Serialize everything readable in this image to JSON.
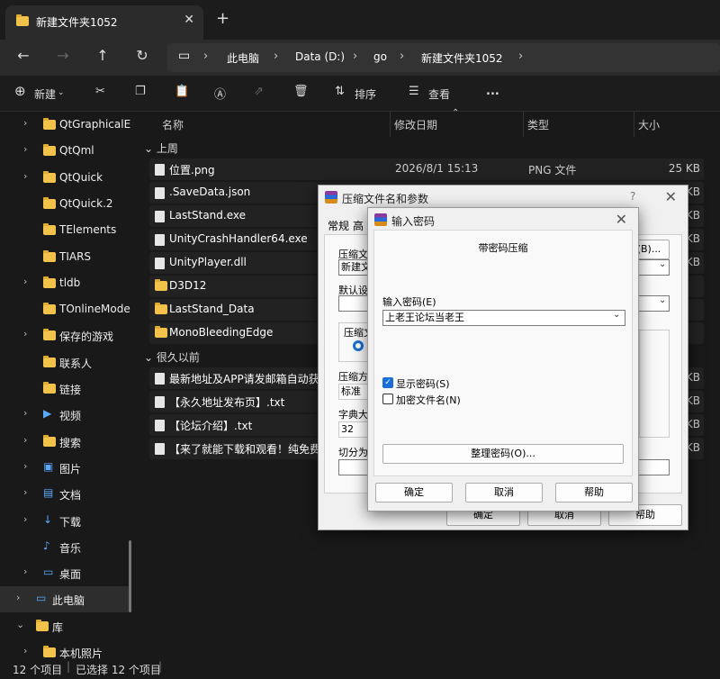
{
  "tab": {
    "title": "新建文件夹1052"
  },
  "address": {
    "crumbs": [
      "此电脑",
      "Data (D:)",
      "go",
      "新建文件夹1052"
    ]
  },
  "toolbar": {
    "new_label": "新建",
    "sort_label": "排序",
    "view_label": "查看",
    "more_label": "..."
  },
  "sidebar": {
    "items": [
      {
        "label": "QtGraphicalE",
        "chev": "›",
        "icon": "folder-icon"
      },
      {
        "label": "QtQml",
        "chev": "›",
        "icon": "folder-icon"
      },
      {
        "label": "QtQuick",
        "chev": "›",
        "icon": "folder-icon"
      },
      {
        "label": "QtQuick.2",
        "chev": "",
        "icon": "folder-icon"
      },
      {
        "label": "TElements",
        "chev": "",
        "icon": "folder-icon"
      },
      {
        "label": "TIARS",
        "chev": "",
        "icon": "folder-icon"
      },
      {
        "label": "tldb",
        "chev": "›",
        "icon": "folder-icon"
      },
      {
        "label": "TOnlineMode",
        "chev": "",
        "icon": "folder-icon"
      },
      {
        "label": "保存的游戏",
        "chev": "›",
        "icon": "folder-icon"
      },
      {
        "label": "联系人",
        "chev": "",
        "icon": "folder-icon"
      },
      {
        "label": "链接",
        "chev": "",
        "icon": "folder-icon"
      },
      {
        "label": "视频",
        "chev": "›",
        "icon": "video-icon"
      },
      {
        "label": "搜索",
        "chev": "›",
        "icon": "folder-icon"
      },
      {
        "label": "图片",
        "chev": "›",
        "icon": "picture-icon"
      },
      {
        "label": "文档",
        "chev": "›",
        "icon": "document-icon"
      },
      {
        "label": "下载",
        "chev": "›",
        "icon": "download-icon"
      },
      {
        "label": "音乐",
        "chev": "",
        "icon": "music-icon"
      },
      {
        "label": "桌面",
        "chev": "›",
        "icon": "desktop-icon"
      },
      {
        "label": "此电脑",
        "chev": "›",
        "icon": "computer-icon"
      },
      {
        "label": "库",
        "chev": "⌄",
        "icon": "folder-icon"
      },
      {
        "label": "本机照片",
        "chev": "›",
        "icon": "folder-icon"
      }
    ]
  },
  "list": {
    "headers": {
      "name": "名称",
      "date": "修改日期",
      "type": "类型",
      "size": "大小"
    },
    "group_recent": "上周",
    "group_old": "很久以前",
    "rows": [
      {
        "name": "位置.png",
        "date": "2026/8/1 15:13",
        "type": "PNG 文件",
        "size": "25 KB"
      },
      {
        "name": ".SaveData.json",
        "date": "",
        "type": "",
        "size": "KB"
      },
      {
        "name": "LastStand.exe",
        "date": "",
        "type": "",
        "size": "KB"
      },
      {
        "name": "UnityCrashHandler64.exe",
        "date": "",
        "type": "",
        "size": "KB"
      },
      {
        "name": "UnityPlayer.dll",
        "date": "",
        "type": "",
        "size": "KB"
      },
      {
        "name": "D3D12",
        "date": "",
        "type": "",
        "size": ""
      },
      {
        "name": "LastStand_Data",
        "date": "",
        "type": "",
        "size": ""
      },
      {
        "name": "MonoBleedingEdge",
        "date": "",
        "type": "",
        "size": ""
      },
      {
        "name": "最新地址及APP请发邮箱自动获取",
        "date": "",
        "type": "",
        "size": "KB"
      },
      {
        "name": "【永久地址发布页】.txt",
        "date": "",
        "type": "",
        "size": "KB"
      },
      {
        "name": "【论坛介绍】.txt",
        "date": "",
        "type": "",
        "size": "KB"
      },
      {
        "name": "【来了就能下载和观看！纯免费！",
        "date": "",
        "type": "",
        "size": "KB"
      }
    ]
  },
  "status": {
    "count": "12 个项目",
    "selected": "已选择 12 个项目"
  },
  "archive_dialog": {
    "title": "压缩文件名和参数",
    "help": "?",
    "tab_general": "常规",
    "tab_next": "高",
    "label_filename": "压缩文",
    "browse": "(B)...",
    "filename_value": "新建文",
    "label_default": "默认设",
    "label_format": "压缩文",
    "label_method": "压缩方",
    "method_value": "标准",
    "label_dict": "字典大",
    "dict_value": "32",
    "label_split": "切分为",
    "ok": "确定",
    "cancel": "取消",
    "helpbtn": "帮助"
  },
  "password_dialog": {
    "title": "输入密码",
    "heading": "带密码压缩",
    "label": "输入密码(E)",
    "value": "上老王论坛当老王",
    "show_password": "显示密码(S)",
    "encrypt_names": "加密文件名(N)",
    "organize": "整理密码(O)...",
    "ok": "确定",
    "cancel": "取消",
    "help": "帮助"
  }
}
